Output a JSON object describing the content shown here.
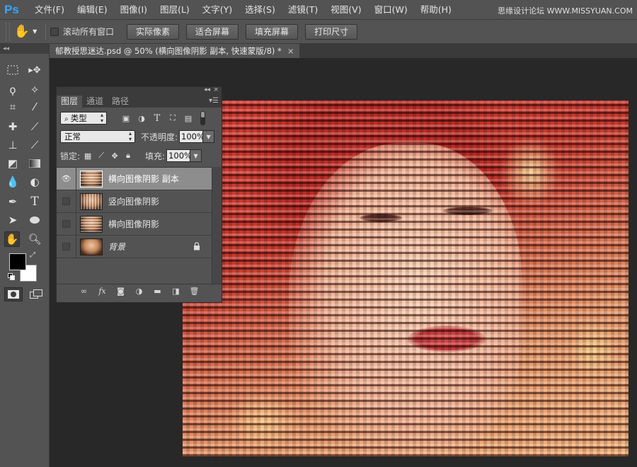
{
  "app": {
    "logo": "Ps",
    "watermark": "思缘设计论坛 WWW.MISSYUAN.COM"
  },
  "menu": [
    "文件(F)",
    "编辑(E)",
    "图像(I)",
    "图层(L)",
    "文字(Y)",
    "选择(S)",
    "滤镜(T)",
    "视图(V)",
    "窗口(W)",
    "帮助(H)"
  ],
  "options": {
    "tool_icon": "hand-icon",
    "scroll_all_label": "滚动所有窗口",
    "scroll_all_checked": false,
    "buttons": [
      "实际像素",
      "适合屏幕",
      "填充屏幕",
      "打印尺寸"
    ]
  },
  "document": {
    "tab_title": "郁教授思迷达.psd @ 50% (横向图像阴影 副本, 快速蒙版/8) *",
    "close": "×"
  },
  "toolbox": {
    "collapse": "◂◂",
    "foreground": "#000000",
    "background": "#ffffff"
  },
  "layers_panel": {
    "collapse": "◂◂",
    "close": "×",
    "tabs": [
      "图层",
      "通道",
      "路径"
    ],
    "active_tab": "图层",
    "filter_kind": "类型",
    "blend_mode": "正常",
    "opacity_label": "不透明度:",
    "opacity": "100%",
    "lock_label": "锁定:",
    "fill_label": "填充:",
    "fill": "100%",
    "layers": [
      {
        "name": "横向图像阴影 副本",
        "visible": true,
        "selected": true,
        "locked": false
      },
      {
        "name": "竖向图像阴影",
        "visible": false,
        "selected": false,
        "locked": false
      },
      {
        "name": "横向图像阴影",
        "visible": false,
        "selected": false,
        "locked": false
      },
      {
        "name": "背景",
        "visible": false,
        "selected": false,
        "locked": true
      }
    ]
  }
}
